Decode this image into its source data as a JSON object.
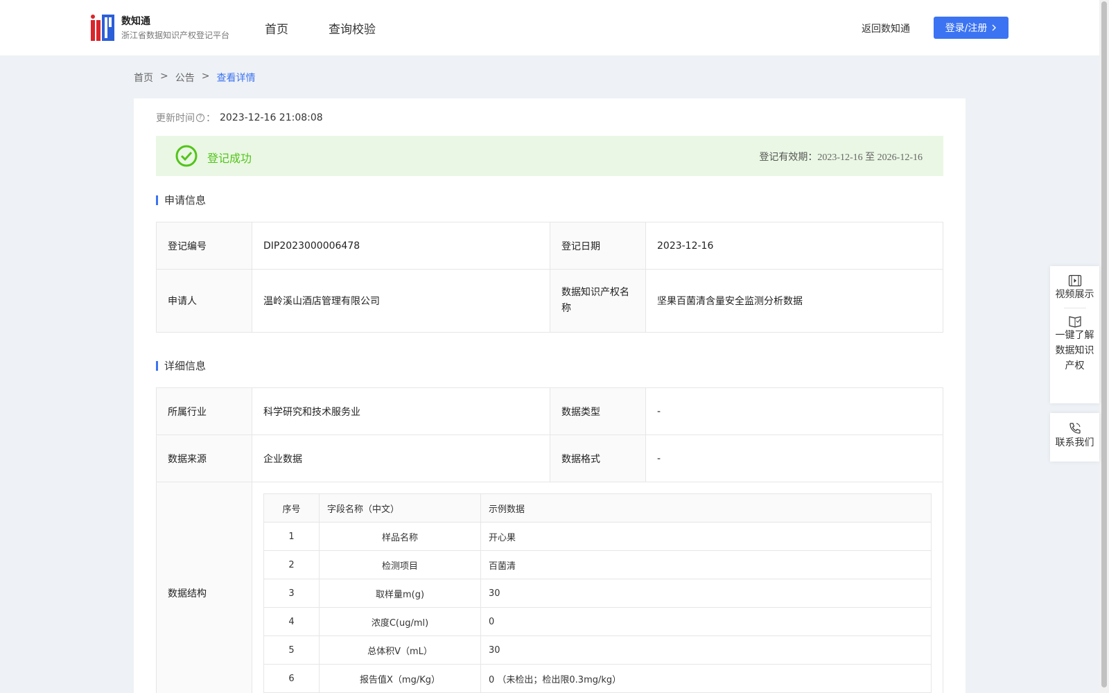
{
  "header": {
    "brand_name": "数知通",
    "brand_sub": "浙江省数据知识产权登记平台",
    "nav": [
      "首页",
      "查询校验"
    ],
    "back_link": "返回数知通",
    "login_label": "登录/注册"
  },
  "breadcrumb": {
    "items": [
      "首页",
      "公告",
      "查看详情"
    ],
    "separator": ">"
  },
  "update": {
    "label": "更新时间",
    "value": "2023-12-16 21:08:08"
  },
  "status": {
    "text": "登记成功",
    "validity_label": "登记有效期：",
    "validity_value": "2023-12-16 至 2026-12-16",
    "color": "#52c41a"
  },
  "apply_info": {
    "title": "申请信息",
    "reg_no_label": "登记编号",
    "reg_no": "DIP2023000006478",
    "reg_date_label": "登记日期",
    "reg_date": "2023-12-16",
    "applicant_label": "申请人",
    "applicant": "温岭溪山酒店管理有限公司",
    "ip_name_label": "数据知识产权名称",
    "ip_name": "坚果百菌清含量安全监测分析数据"
  },
  "detail_info": {
    "title": "详细信息",
    "industry_label": "所属行业",
    "industry": "科学研究和技术服务业",
    "data_type_label": "数据类型",
    "data_type": "-",
    "source_label": "数据来源",
    "source": "企业数据",
    "format_label": "数据格式",
    "format": "-",
    "structure_label": "数据结构",
    "structure_headers": [
      "序号",
      "字段名称（中文）",
      "示例数据"
    ],
    "structure_rows": [
      {
        "no": "1",
        "field": "样品名称",
        "example": "开心果"
      },
      {
        "no": "2",
        "field": "检测项目",
        "example": "百菌清"
      },
      {
        "no": "3",
        "field": "取样量m(g)",
        "example": "30"
      },
      {
        "no": "4",
        "field": "浓度C(ug/ml)",
        "example": "0"
      },
      {
        "no": "5",
        "field": "总体积V（mL）",
        "example": "30"
      },
      {
        "no": "6",
        "field": "报告值X（mg/Kg）",
        "example": "0 （未检出；检出限0.3mg/kg）"
      }
    ]
  },
  "side_panel": {
    "video": "视频展示",
    "learn": "一键了解数据知识产权",
    "contact": "联系我们"
  },
  "colors": {
    "accent": "#3b73f2",
    "success_bg": "#eaf7e4"
  }
}
